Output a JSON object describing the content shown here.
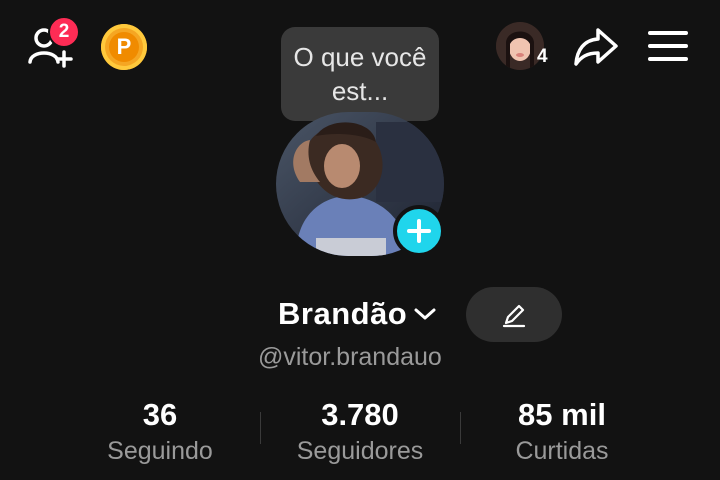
{
  "top_bar": {
    "add_friend_badge": "2",
    "coin_letter": "P",
    "story_count": "4",
    "icons": {
      "add_friend": "person-plus-icon",
      "coin": "coin-icon",
      "share": "share-arrow-icon",
      "menu": "hamburger-menu-icon"
    }
  },
  "status_bubble": {
    "text": "O que você est..."
  },
  "profile": {
    "display_name": "Brandão",
    "username": "@vitor.brandauo"
  },
  "stats": [
    {
      "value": "36",
      "label": "Seguindo"
    },
    {
      "value": "3.780",
      "label": "Seguidores"
    },
    {
      "value": "85 mil",
      "label": "Curtidas"
    }
  ],
  "colors": {
    "background": "#121212",
    "badge": "#fe2c55",
    "add_button": "#20d5ec",
    "coin": "#f5a623",
    "secondary_text": "#9a9a9a"
  }
}
